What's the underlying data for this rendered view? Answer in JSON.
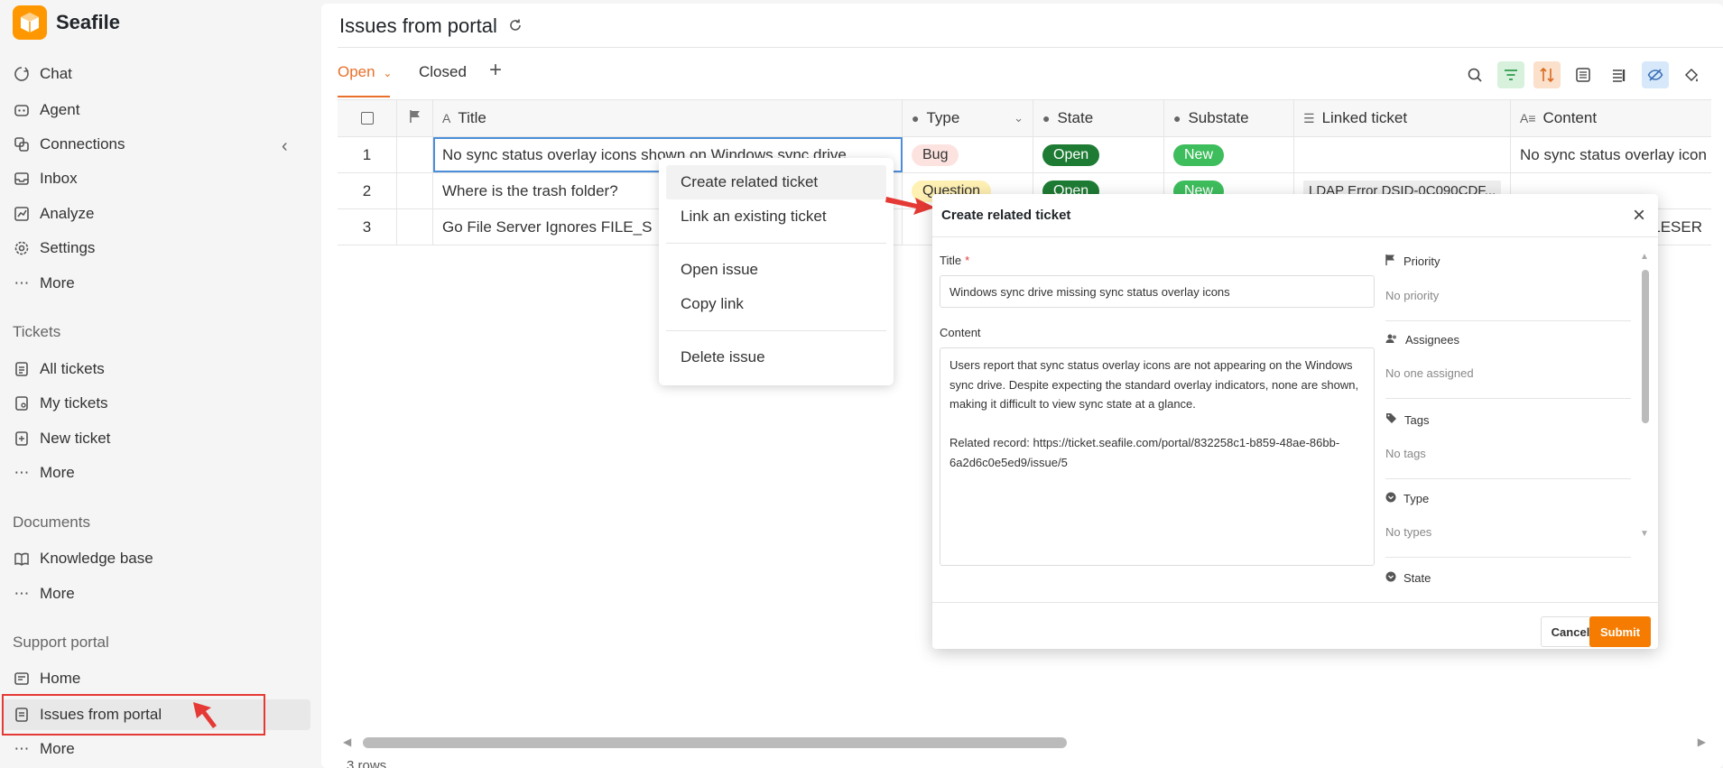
{
  "brand": {
    "name": "Seafile"
  },
  "sidebar": {
    "main_items": [
      {
        "label": "Chat",
        "icon": "chat-icon"
      },
      {
        "label": "Agent",
        "icon": "agent-icon"
      },
      {
        "label": "Connections",
        "icon": "connections-icon"
      },
      {
        "label": "Inbox",
        "icon": "inbox-icon"
      },
      {
        "label": "Analyze",
        "icon": "analyze-icon"
      },
      {
        "label": "Settings",
        "icon": "gear-icon"
      },
      {
        "label": "More",
        "icon": "more-icon"
      }
    ],
    "tickets_section": "Tickets",
    "tickets_items": [
      {
        "label": "All tickets"
      },
      {
        "label": "My tickets"
      },
      {
        "label": "New ticket"
      },
      {
        "label": "More"
      }
    ],
    "documents_section": "Documents",
    "documents_items": [
      {
        "label": "Knowledge base"
      },
      {
        "label": "More"
      }
    ],
    "portal_section": "Support portal",
    "portal_items": [
      {
        "label": "Home"
      },
      {
        "label": "Issues from portal"
      },
      {
        "label": "More"
      }
    ]
  },
  "page": {
    "title": "Issues from portal",
    "views": {
      "open": "Open",
      "closed": "Closed"
    },
    "row_count": "3 rows"
  },
  "table": {
    "headers": {
      "title": "Title",
      "type": "Type",
      "state": "State",
      "substate": "Substate",
      "linked": "Linked ticket",
      "content": "Content"
    },
    "rows": [
      {
        "num": "1",
        "title": "No sync status overlay icons shown on Windows sync drive",
        "type": "Bug",
        "state": "Open",
        "substate": "New",
        "linked": "",
        "content": "No sync status overlay icon"
      },
      {
        "num": "2",
        "title": "Where is the trash folder?",
        "type": "Question",
        "state": "Open",
        "substate": "New",
        "linked": "LDAP Error DSID-0C090CDF...",
        "content": ""
      },
      {
        "num": "3",
        "title": "Go File Server Ignores FILE_S",
        "type": "",
        "state": "",
        "substate": "",
        "linked": "",
        "content": "LESER"
      }
    ]
  },
  "context_menu": {
    "create_related": "Create related ticket",
    "link_existing": "Link an existing ticket",
    "open_issue": "Open issue",
    "copy_link": "Copy link",
    "delete_issue": "Delete issue"
  },
  "dialog": {
    "heading": "Create related ticket",
    "title_label": "Title",
    "title_required": "*",
    "title_value": "Windows sync drive missing sync status overlay icons",
    "content_label": "Content",
    "content_value": "Users report that sync status overlay icons are not appearing on the Windows sync drive. Despite expecting the standard overlay indicators, none are shown, making it difficult to view sync state at a glance.\n\nRelated record: https://ticket.seafile.com/portal/832258c1-b859-48ae-86bb-6a2d6c0e5ed9/issue/5",
    "priority_label": "Priority",
    "priority_value": "No priority",
    "assignees_label": "Assignees",
    "assignees_value": "No one assigned",
    "tags_label": "Tags",
    "tags_value": "No tags",
    "type_label": "Type",
    "type_value": "No types",
    "state_label": "State",
    "cancel": "Cancel",
    "submit": "Submit"
  },
  "colors": {
    "accent": "#e8702a",
    "brand": "#ff9800",
    "submit": "#f57c00",
    "open_badge": "#1e7b34",
    "new_badge": "#3dbd5c",
    "annotation_red": "#e53935"
  }
}
